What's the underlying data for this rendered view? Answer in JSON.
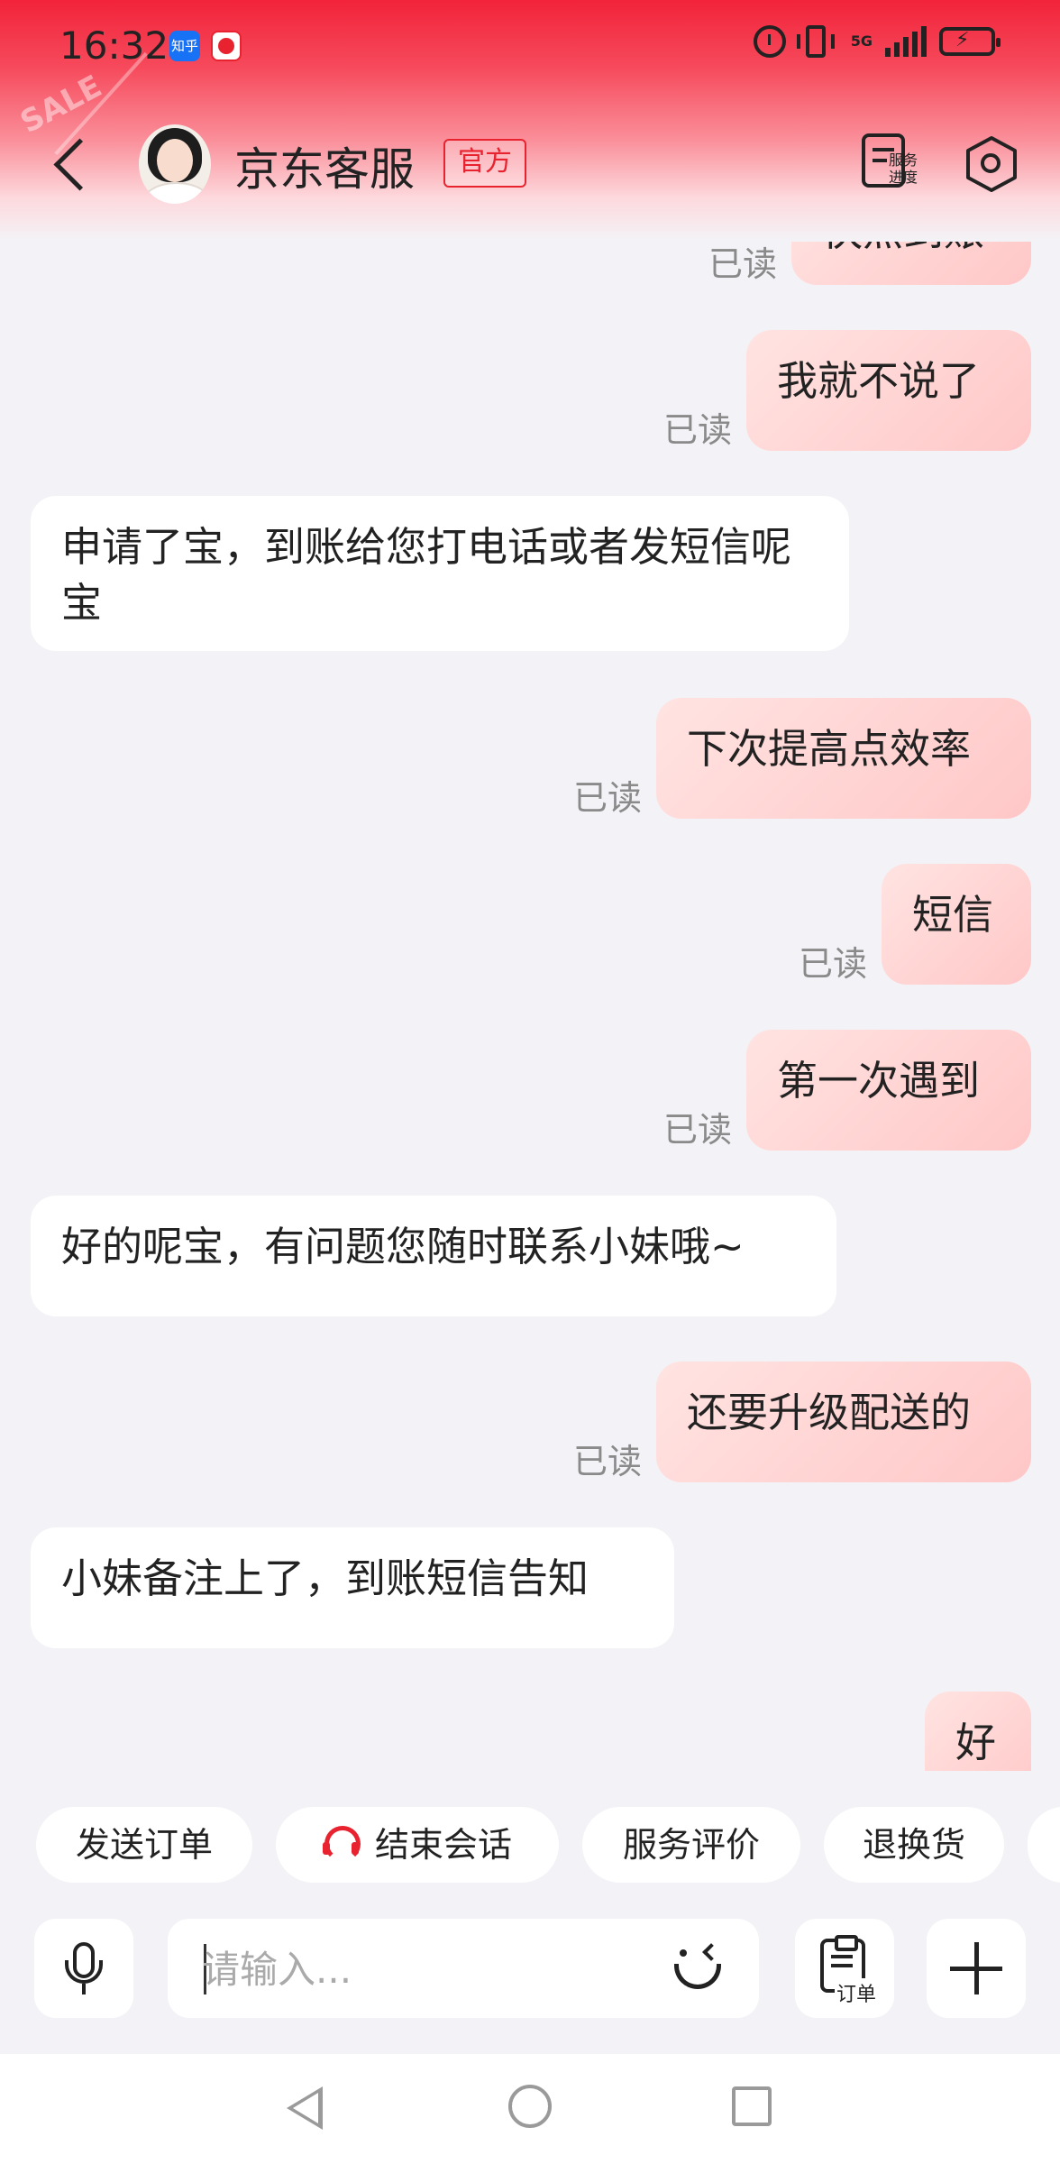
{
  "status_bar": {
    "time": "16:32",
    "app_icons": [
      "zhihu-icon",
      "app-notification-icon"
    ],
    "zhihu_label": "知乎",
    "network": "5G",
    "right_icons": [
      "alarm-icon",
      "vibrate-icon",
      "signal-icon",
      "battery-charging-icon"
    ]
  },
  "header": {
    "decoration": "SALE",
    "title": "京东客服",
    "badge": "官方",
    "progress_label": "服务进度",
    "icons": [
      "back-icon",
      "settings-icon"
    ]
  },
  "messages": [
    {
      "side": "sent",
      "text": "快点到账",
      "status": "已读"
    },
    {
      "side": "sent",
      "text": "我就不说了",
      "status": "已读"
    },
    {
      "side": "received",
      "text": "申请了宝，到账给您打电话或者发短信呢宝"
    },
    {
      "side": "sent",
      "text": "下次提高点效率",
      "status": "已读"
    },
    {
      "side": "sent",
      "text": "短信",
      "status": "已读"
    },
    {
      "side": "sent",
      "text": "第一次遇到",
      "status": "已读"
    },
    {
      "side": "received",
      "text": "好的呢宝，有问题您随时联系小妹哦~"
    },
    {
      "side": "sent",
      "text": "还要升级配送的",
      "status": "已读"
    },
    {
      "side": "received",
      "text": "小妹备注上了，到账短信告知"
    },
    {
      "side": "sent",
      "text": "好"
    }
  ],
  "quick_actions": [
    {
      "label": "发送订单",
      "icon": null
    },
    {
      "label": "结束会话",
      "icon": "headset-icon"
    },
    {
      "label": "服务评价",
      "icon": null
    },
    {
      "label": "退换货",
      "icon": null
    }
  ],
  "input_bar": {
    "placeholder": "请输入...",
    "value": "",
    "order_label": "订单",
    "icons": [
      "microphone-icon",
      "emoji-icon",
      "order-clipboard-icon",
      "plus-icon"
    ]
  },
  "nav_bar": {
    "icons": [
      "nav-back-icon",
      "nav-home-icon",
      "nav-recent-apps-icon"
    ]
  },
  "colors": {
    "brand_red": "#e8232f",
    "sent_bubble": "#ffd0cf",
    "received_bubble": "#ffffff",
    "background": "#f3f3f7",
    "read_text": "#8a8a8a"
  }
}
